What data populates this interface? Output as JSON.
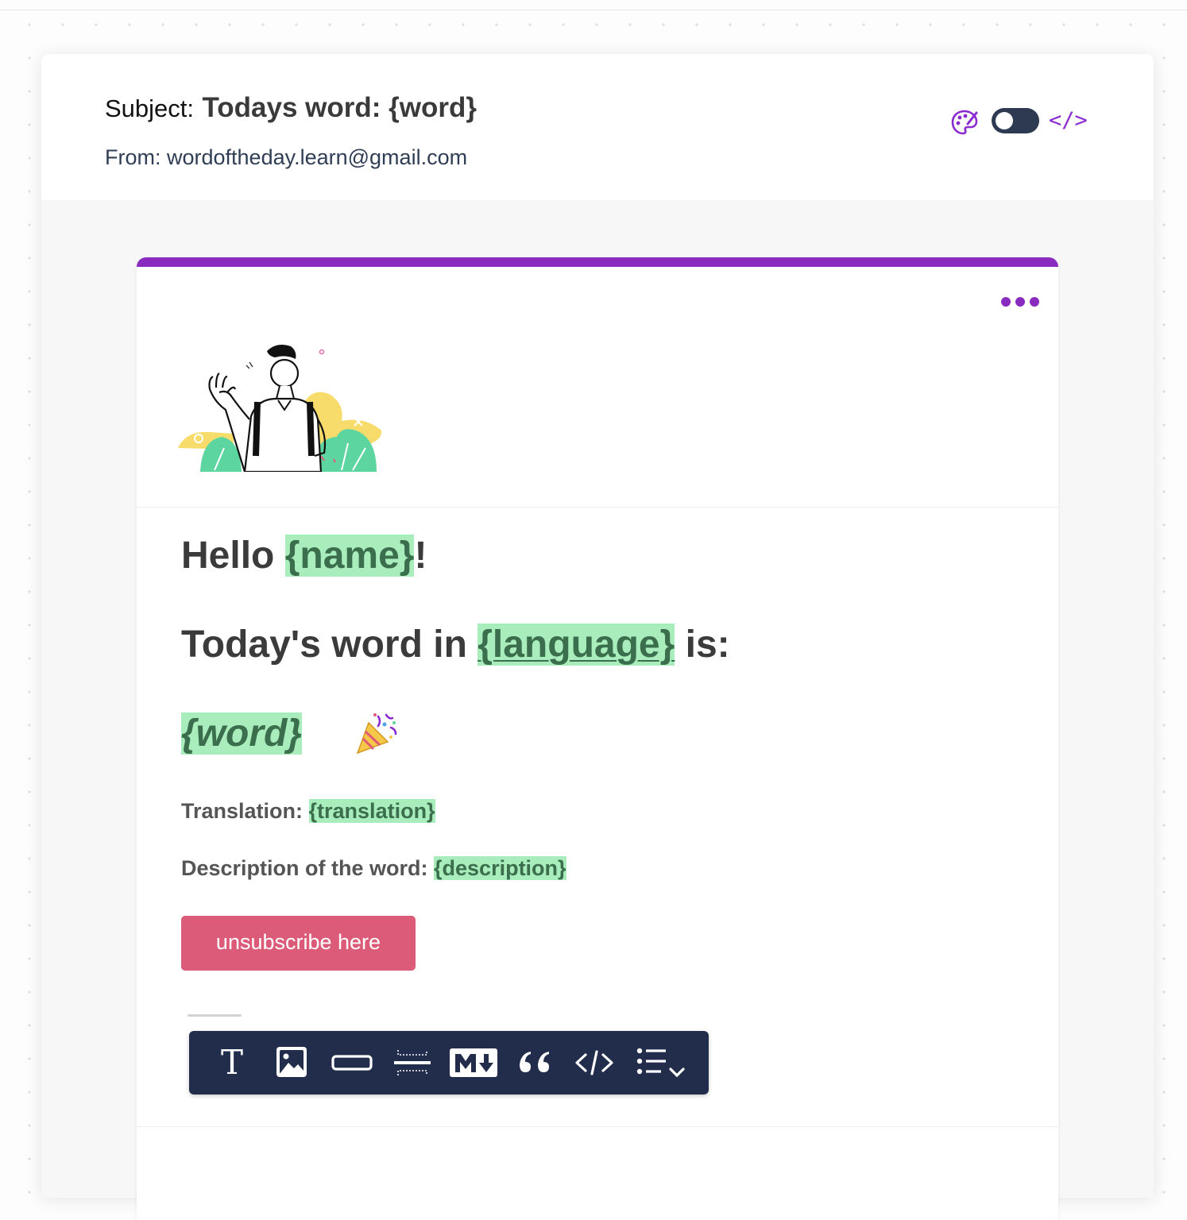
{
  "header": {
    "subject_label": "Subject:",
    "subject_value": "Todays word: {word}",
    "from_text": "From: wordoftheday.learn@gmail.com",
    "code_toggle_label": "</>"
  },
  "email": {
    "greeting": {
      "prefix": "Hello ",
      "variable": "{name}",
      "suffix": "!"
    },
    "word_line": {
      "prefix": "Today's word in ",
      "variable": "{language}",
      "suffix": " is:"
    },
    "word_variable": "{word}",
    "translation": {
      "label": "Translation: ",
      "variable": "{translation}"
    },
    "description": {
      "label": "Description of the word: ",
      "variable": "{description}"
    },
    "unsubscribe_button": "unsubscribe here"
  },
  "toolbar": {
    "items": [
      {
        "name": "text-icon"
      },
      {
        "name": "image-icon"
      },
      {
        "name": "button-icon"
      },
      {
        "name": "divider-icon"
      },
      {
        "name": "markdown-icon"
      },
      {
        "name": "quote-icon"
      },
      {
        "name": "code-icon"
      },
      {
        "name": "list-dropdown-icon"
      }
    ]
  },
  "colors": {
    "accent": "#8a2bbf",
    "variable_highlight": "#a9edbc",
    "button": "#dc5b78",
    "toolbar": "#222d4b"
  }
}
